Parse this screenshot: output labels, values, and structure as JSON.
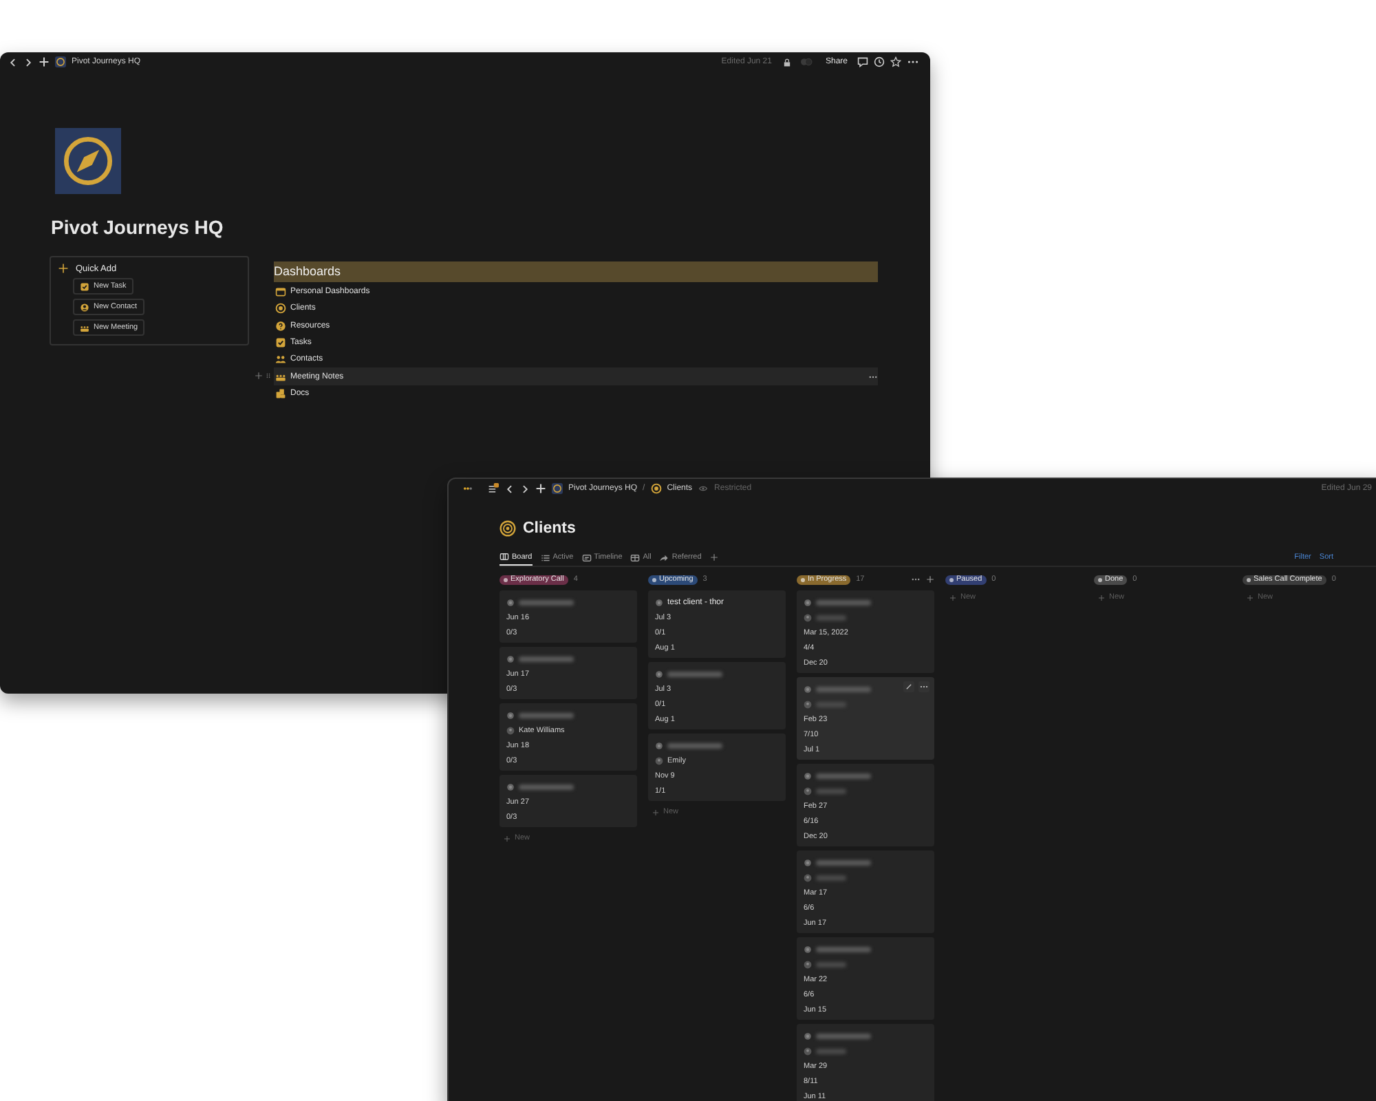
{
  "page_window": {
    "toolbar": {
      "page_title": "Pivot Journeys HQ",
      "edited": "Edited Jun 21",
      "share": "Share"
    },
    "title": "Pivot Journeys HQ",
    "quick_add": {
      "heading": "Quick Add",
      "buttons": [
        {
          "label": "New Task",
          "kind": "check"
        },
        {
          "label": "New Contact",
          "kind": "person"
        },
        {
          "label": "New Meeting",
          "kind": "people"
        }
      ]
    },
    "dashboards": {
      "heading": "Dashboards",
      "items": [
        {
          "label": "Personal Dashboards",
          "kind": "window",
          "hovered": false
        },
        {
          "label": "Clients",
          "kind": "target",
          "hovered": false
        },
        {
          "label": "Resources",
          "kind": "help",
          "hovered": false
        },
        {
          "label": "Tasks",
          "kind": "check",
          "hovered": false
        },
        {
          "label": "Contacts",
          "kind": "contacts",
          "hovered": false
        },
        {
          "label": "Meeting Notes",
          "kind": "people",
          "hovered": true
        },
        {
          "label": "Docs",
          "kind": "docs",
          "hovered": false
        }
      ]
    }
  },
  "database_window": {
    "breadcrumbs": [
      "Pivot Journeys HQ",
      "Clients"
    ],
    "separator": "/",
    "access": "Restricted",
    "edited": "Edited Jun 29",
    "title": "Clients",
    "views": [
      {
        "label": "Board",
        "kind": "board",
        "selected": true
      },
      {
        "label": "Active",
        "kind": "list",
        "selected": false
      },
      {
        "label": "Timeline",
        "kind": "timeline",
        "selected": false
      },
      {
        "label": "All",
        "kind": "table",
        "selected": false
      },
      {
        "label": "Referred",
        "kind": "share",
        "selected": false
      }
    ],
    "actions": [
      "Filter",
      "Sort"
    ],
    "groups": [
      {
        "label": "Exploratory Call",
        "color": "#6b2f48",
        "count": "4",
        "hovered": false,
        "new_label": "New",
        "cards": [
          {
            "redacted": true,
            "hovered": false,
            "props": [
              {
                "kind": "line",
                "text": "Jun 16"
              },
              {
                "kind": "line",
                "text": "0/3"
              }
            ]
          },
          {
            "redacted": true,
            "hovered": false,
            "props": [
              {
                "kind": "line",
                "text": "Jun 17"
              },
              {
                "kind": "line",
                "text": "0/3"
              }
            ]
          },
          {
            "redacted": true,
            "hovered": false,
            "props": [
              {
                "kind": "person",
                "text": "Kate Williams"
              },
              {
                "kind": "line",
                "text": "Jun 18"
              },
              {
                "kind": "line",
                "text": "0/3"
              }
            ]
          },
          {
            "redacted": true,
            "hovered": false,
            "props": [
              {
                "kind": "line",
                "text": "Jun 27"
              },
              {
                "kind": "line",
                "text": "0/3"
              }
            ]
          }
        ]
      },
      {
        "label": "Upcoming",
        "color": "#2c4a78",
        "count": "3",
        "hovered": false,
        "new_label": "New",
        "cards": [
          {
            "redacted": false,
            "title": "test client - thor",
            "hovered": false,
            "props": [
              {
                "kind": "line",
                "text": "Jul 3"
              },
              {
                "kind": "line",
                "text": "0/1"
              },
              {
                "kind": "line",
                "text": "Aug 1"
              }
            ]
          },
          {
            "redacted": true,
            "hovered": false,
            "props": [
              {
                "kind": "line",
                "text": "Jul 3"
              },
              {
                "kind": "line",
                "text": "0/1"
              },
              {
                "kind": "line",
                "text": "Aug 1"
              }
            ]
          },
          {
            "redacted": true,
            "hovered": false,
            "props": [
              {
                "kind": "person",
                "text": "Emily"
              },
              {
                "kind": "line",
                "text": "Nov 9"
              },
              {
                "kind": "line",
                "text": "1/1"
              }
            ]
          }
        ]
      },
      {
        "label": "In Progress",
        "color": "#8a6a2e",
        "count": "17",
        "hovered": true,
        "cards": [
          {
            "redacted": true,
            "hovered": false,
            "props": [
              {
                "kind": "person",
                "redacted": true
              },
              {
                "kind": "line",
                "text": "Mar 15, 2022"
              },
              {
                "kind": "line",
                "text": "4/4"
              },
              {
                "kind": "line",
                "text": "Dec 20"
              }
            ]
          },
          {
            "redacted": true,
            "hovered": true,
            "props": [
              {
                "kind": "person",
                "redacted": true
              },
              {
                "kind": "line",
                "text": "Feb 23"
              },
              {
                "kind": "line",
                "text": "7/10"
              },
              {
                "kind": "line",
                "text": "Jul 1"
              }
            ]
          },
          {
            "redacted": true,
            "hovered": false,
            "props": [
              {
                "kind": "person",
                "redacted": true
              },
              {
                "kind": "line",
                "text": "Feb 27"
              },
              {
                "kind": "line",
                "text": "6/16"
              },
              {
                "kind": "line",
                "text": "Dec 20"
              }
            ]
          },
          {
            "redacted": true,
            "hovered": false,
            "props": [
              {
                "kind": "person",
                "redacted": true
              },
              {
                "kind": "line",
                "text": "Mar 17"
              },
              {
                "kind": "line",
                "text": "6/6"
              },
              {
                "kind": "line",
                "text": "Jun 17"
              }
            ]
          },
          {
            "redacted": true,
            "hovered": false,
            "props": [
              {
                "kind": "person",
                "redacted": true
              },
              {
                "kind": "line",
                "text": "Mar 22"
              },
              {
                "kind": "line",
                "text": "6/6"
              },
              {
                "kind": "line",
                "text": "Jun 15"
              }
            ]
          },
          {
            "redacted": true,
            "hovered": false,
            "props": [
              {
                "kind": "person",
                "redacted": true
              },
              {
                "kind": "line",
                "text": "Mar 29"
              },
              {
                "kind": "line",
                "text": "8/11"
              },
              {
                "kind": "line",
                "text": "Jun 11"
              }
            ]
          }
        ]
      },
      {
        "label": "Paused",
        "color": "#323f72",
        "count": "0",
        "hovered": false,
        "new_label": "New"
      },
      {
        "label": "Done",
        "color": "#4a4a4a",
        "count": "0",
        "hovered": false,
        "new_label": "New"
      },
      {
        "label": "Sales Call Complete",
        "color": "#3c3c3c",
        "count": "0",
        "hovered": false,
        "new_label": "New"
      }
    ]
  }
}
